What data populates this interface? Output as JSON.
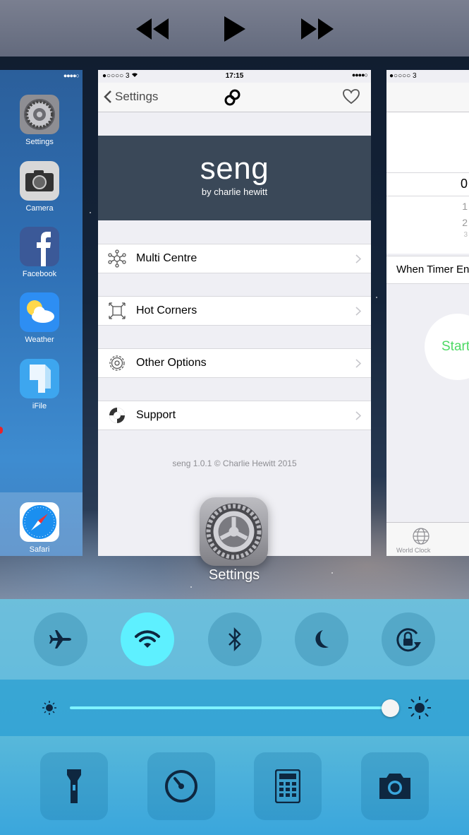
{
  "media": {
    "buttons": [
      "rewind",
      "play",
      "fast-forward"
    ]
  },
  "home_card": {
    "apps": [
      {
        "label": "Settings",
        "icon": "settings-icon"
      },
      {
        "label": "Camera",
        "icon": "camera-icon"
      },
      {
        "label": "Facebook",
        "icon": "facebook-icon"
      },
      {
        "label": "Weather",
        "icon": "weather-icon"
      },
      {
        "label": "iFile",
        "icon": "ifile-icon"
      }
    ],
    "dock_app": {
      "label": "Safari",
      "icon": "safari-icon"
    }
  },
  "main_card": {
    "status": {
      "carrier": "●○○○○ 3",
      "time": "17:15"
    },
    "nav": {
      "back_label": "Settings"
    },
    "banner": {
      "title": "seng",
      "subtitle": "by charlie hewitt"
    },
    "rows": [
      {
        "label": "Multi Centre",
        "icon": "hub-icon"
      },
      {
        "label": "Hot Corners",
        "icon": "corners-icon"
      },
      {
        "label": "Other Options",
        "icon": "gear-icon"
      },
      {
        "label": "Support",
        "icon": "lifebuoy-icon"
      }
    ],
    "footer": "seng 1.0.1 © Charlie Hewitt 2015"
  },
  "right_card": {
    "status": {
      "carrier": "●○○○○ 3"
    },
    "picker_values": [
      "0",
      "1",
      "2",
      "3"
    ],
    "row_label": "When Timer Ends",
    "start_label": "Start",
    "tab_label": "World Clock"
  },
  "switcher": {
    "focused_app_label": "Settings"
  },
  "control_center": {
    "toggles": [
      {
        "name": "airplane-icon",
        "on": false
      },
      {
        "name": "wifi-icon",
        "on": true
      },
      {
        "name": "bluetooth-icon",
        "on": false
      },
      {
        "name": "moon-icon",
        "on": false
      },
      {
        "name": "rotation-lock-icon",
        "on": false
      }
    ],
    "brightness": 0.95,
    "tools": [
      "flashlight-icon",
      "timer-icon",
      "calculator-icon",
      "camera-icon"
    ]
  },
  "colors": {
    "accent_on": "#5ef0ff",
    "banner_bg": "#3a4858",
    "start_green": "#4cd964"
  }
}
